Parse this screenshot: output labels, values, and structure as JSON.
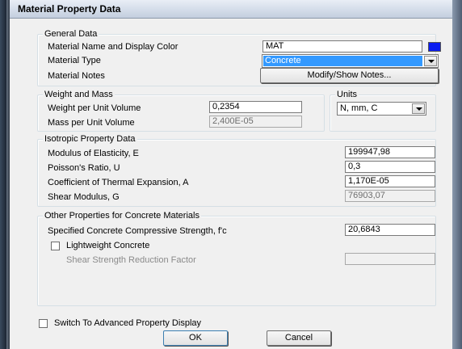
{
  "window": {
    "title": "Material Property Data"
  },
  "general": {
    "legend": "General Data",
    "name_label": "Material Name and Display Color",
    "name_value": "MAT",
    "display_color": "#0a1cf0",
    "type_label": "Material Type",
    "type_value": "Concrete",
    "notes_label": "Material Notes",
    "notes_button": "Modify/Show Notes..."
  },
  "weight": {
    "legend": "Weight and Mass",
    "weight_label": "Weight per Unit Volume",
    "weight_value": "0,2354",
    "mass_label": "Mass per Unit Volume",
    "mass_value": "2,400E-05"
  },
  "units": {
    "legend": "Units",
    "value": "N, mm, C"
  },
  "isotropic": {
    "legend": "Isotropic Property Data",
    "e_label": "Modulus of Elasticity,  E",
    "e_value": "199947,98",
    "u_label": "Poisson's Ratio,  U",
    "u_value": "0,3",
    "a_label": "Coefficient of Thermal Expansion,  A",
    "a_value": "1,170E-05",
    "g_label": "Shear Modulus,  G",
    "g_value": "76903,07"
  },
  "concrete": {
    "legend": "Other Properties for Concrete Materials",
    "fc_label": "Specified Concrete Compressive Strength, f'c",
    "fc_value": "20,6843",
    "lightweight_label": "Lightweight Concrete",
    "lightweight_checked": false,
    "ssrf_label": "Shear Strength Reduction Factor",
    "ssrf_value": ""
  },
  "advanced": {
    "label": "Switch To Advanced Property Display",
    "checked": false
  },
  "buttons": {
    "ok": "OK",
    "cancel": "Cancel"
  }
}
